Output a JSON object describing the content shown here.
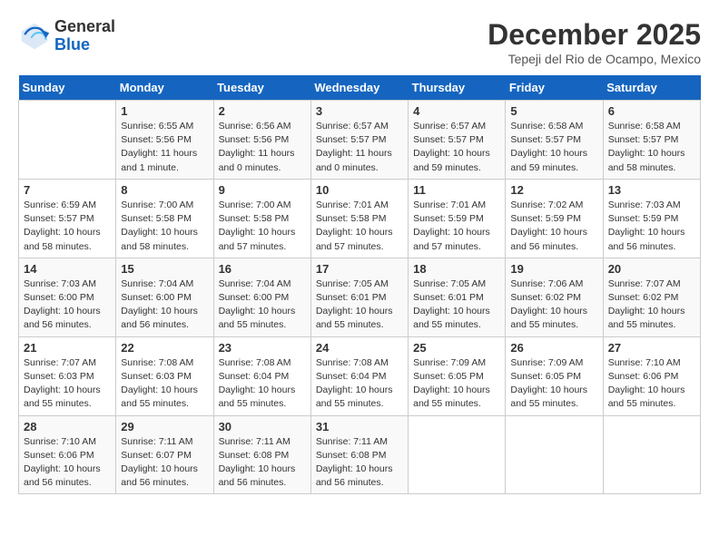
{
  "logo": {
    "general": "General",
    "blue": "Blue"
  },
  "header": {
    "month_year": "December 2025",
    "location": "Tepeji del Rio de Ocampo, Mexico"
  },
  "weekdays": [
    "Sunday",
    "Monday",
    "Tuesday",
    "Wednesday",
    "Thursday",
    "Friday",
    "Saturday"
  ],
  "weeks": [
    [
      {
        "day": "",
        "sunrise": "",
        "sunset": "",
        "daylight": ""
      },
      {
        "day": "1",
        "sunrise": "Sunrise: 6:55 AM",
        "sunset": "Sunset: 5:56 PM",
        "daylight": "Daylight: 11 hours and 1 minute."
      },
      {
        "day": "2",
        "sunrise": "Sunrise: 6:56 AM",
        "sunset": "Sunset: 5:56 PM",
        "daylight": "Daylight: 11 hours and 0 minutes."
      },
      {
        "day": "3",
        "sunrise": "Sunrise: 6:57 AM",
        "sunset": "Sunset: 5:57 PM",
        "daylight": "Daylight: 11 hours and 0 minutes."
      },
      {
        "day": "4",
        "sunrise": "Sunrise: 6:57 AM",
        "sunset": "Sunset: 5:57 PM",
        "daylight": "Daylight: 10 hours and 59 minutes."
      },
      {
        "day": "5",
        "sunrise": "Sunrise: 6:58 AM",
        "sunset": "Sunset: 5:57 PM",
        "daylight": "Daylight: 10 hours and 59 minutes."
      },
      {
        "day": "6",
        "sunrise": "Sunrise: 6:58 AM",
        "sunset": "Sunset: 5:57 PM",
        "daylight": "Daylight: 10 hours and 58 minutes."
      }
    ],
    [
      {
        "day": "7",
        "sunrise": "Sunrise: 6:59 AM",
        "sunset": "Sunset: 5:57 PM",
        "daylight": "Daylight: 10 hours and 58 minutes."
      },
      {
        "day": "8",
        "sunrise": "Sunrise: 7:00 AM",
        "sunset": "Sunset: 5:58 PM",
        "daylight": "Daylight: 10 hours and 58 minutes."
      },
      {
        "day": "9",
        "sunrise": "Sunrise: 7:00 AM",
        "sunset": "Sunset: 5:58 PM",
        "daylight": "Daylight: 10 hours and 57 minutes."
      },
      {
        "day": "10",
        "sunrise": "Sunrise: 7:01 AM",
        "sunset": "Sunset: 5:58 PM",
        "daylight": "Daylight: 10 hours and 57 minutes."
      },
      {
        "day": "11",
        "sunrise": "Sunrise: 7:01 AM",
        "sunset": "Sunset: 5:59 PM",
        "daylight": "Daylight: 10 hours and 57 minutes."
      },
      {
        "day": "12",
        "sunrise": "Sunrise: 7:02 AM",
        "sunset": "Sunset: 5:59 PM",
        "daylight": "Daylight: 10 hours and 56 minutes."
      },
      {
        "day": "13",
        "sunrise": "Sunrise: 7:03 AM",
        "sunset": "Sunset: 5:59 PM",
        "daylight": "Daylight: 10 hours and 56 minutes."
      }
    ],
    [
      {
        "day": "14",
        "sunrise": "Sunrise: 7:03 AM",
        "sunset": "Sunset: 6:00 PM",
        "daylight": "Daylight: 10 hours and 56 minutes."
      },
      {
        "day": "15",
        "sunrise": "Sunrise: 7:04 AM",
        "sunset": "Sunset: 6:00 PM",
        "daylight": "Daylight: 10 hours and 56 minutes."
      },
      {
        "day": "16",
        "sunrise": "Sunrise: 7:04 AM",
        "sunset": "Sunset: 6:00 PM",
        "daylight": "Daylight: 10 hours and 55 minutes."
      },
      {
        "day": "17",
        "sunrise": "Sunrise: 7:05 AM",
        "sunset": "Sunset: 6:01 PM",
        "daylight": "Daylight: 10 hours and 55 minutes."
      },
      {
        "day": "18",
        "sunrise": "Sunrise: 7:05 AM",
        "sunset": "Sunset: 6:01 PM",
        "daylight": "Daylight: 10 hours and 55 minutes."
      },
      {
        "day": "19",
        "sunrise": "Sunrise: 7:06 AM",
        "sunset": "Sunset: 6:02 PM",
        "daylight": "Daylight: 10 hours and 55 minutes."
      },
      {
        "day": "20",
        "sunrise": "Sunrise: 7:07 AM",
        "sunset": "Sunset: 6:02 PM",
        "daylight": "Daylight: 10 hours and 55 minutes."
      }
    ],
    [
      {
        "day": "21",
        "sunrise": "Sunrise: 7:07 AM",
        "sunset": "Sunset: 6:03 PM",
        "daylight": "Daylight: 10 hours and 55 minutes."
      },
      {
        "day": "22",
        "sunrise": "Sunrise: 7:08 AM",
        "sunset": "Sunset: 6:03 PM",
        "daylight": "Daylight: 10 hours and 55 minutes."
      },
      {
        "day": "23",
        "sunrise": "Sunrise: 7:08 AM",
        "sunset": "Sunset: 6:04 PM",
        "daylight": "Daylight: 10 hours and 55 minutes."
      },
      {
        "day": "24",
        "sunrise": "Sunrise: 7:08 AM",
        "sunset": "Sunset: 6:04 PM",
        "daylight": "Daylight: 10 hours and 55 minutes."
      },
      {
        "day": "25",
        "sunrise": "Sunrise: 7:09 AM",
        "sunset": "Sunset: 6:05 PM",
        "daylight": "Daylight: 10 hours and 55 minutes."
      },
      {
        "day": "26",
        "sunrise": "Sunrise: 7:09 AM",
        "sunset": "Sunset: 6:05 PM",
        "daylight": "Daylight: 10 hours and 55 minutes."
      },
      {
        "day": "27",
        "sunrise": "Sunrise: 7:10 AM",
        "sunset": "Sunset: 6:06 PM",
        "daylight": "Daylight: 10 hours and 55 minutes."
      }
    ],
    [
      {
        "day": "28",
        "sunrise": "Sunrise: 7:10 AM",
        "sunset": "Sunset: 6:06 PM",
        "daylight": "Daylight: 10 hours and 56 minutes."
      },
      {
        "day": "29",
        "sunrise": "Sunrise: 7:11 AM",
        "sunset": "Sunset: 6:07 PM",
        "daylight": "Daylight: 10 hours and 56 minutes."
      },
      {
        "day": "30",
        "sunrise": "Sunrise: 7:11 AM",
        "sunset": "Sunset: 6:08 PM",
        "daylight": "Daylight: 10 hours and 56 minutes."
      },
      {
        "day": "31",
        "sunrise": "Sunrise: 7:11 AM",
        "sunset": "Sunset: 6:08 PM",
        "daylight": "Daylight: 10 hours and 56 minutes."
      },
      {
        "day": "",
        "sunrise": "",
        "sunset": "",
        "daylight": ""
      },
      {
        "day": "",
        "sunrise": "",
        "sunset": "",
        "daylight": ""
      },
      {
        "day": "",
        "sunrise": "",
        "sunset": "",
        "daylight": ""
      }
    ]
  ]
}
